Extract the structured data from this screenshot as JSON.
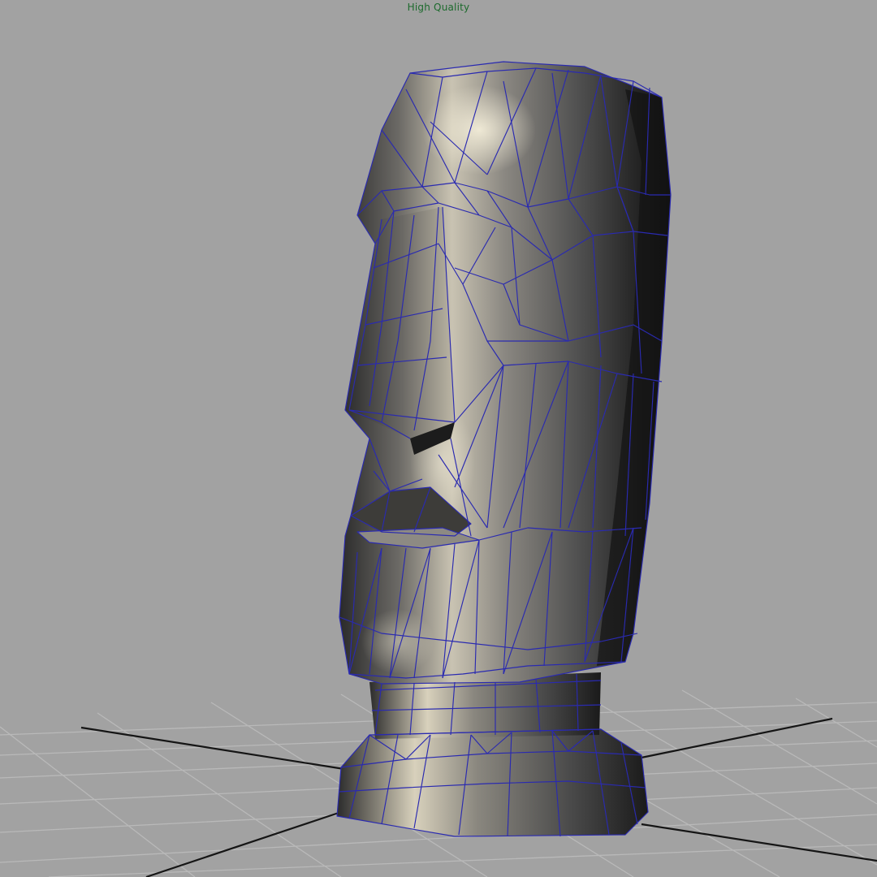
{
  "viewport": {
    "hud_label": "High Quality",
    "display_mode": "smooth-shade-with-wireframe",
    "colors": {
      "background": "#a2a2a2",
      "hud_text": "#1c6a2c",
      "wireframe": "#2a2ab0",
      "grid": "#b9b9b9",
      "axis": "#151515",
      "surface_dark": "#1e1e1e",
      "surface_light": "#e8e2cf"
    }
  }
}
